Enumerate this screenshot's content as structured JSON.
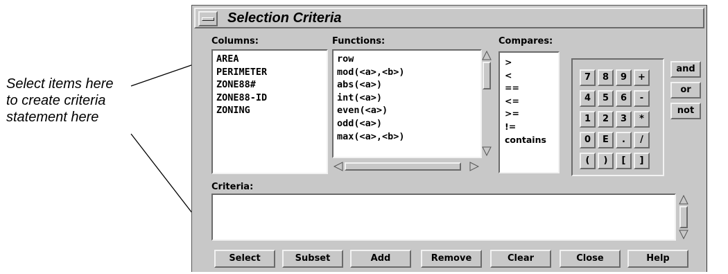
{
  "annotation": {
    "line1": "Select items here",
    "line2": "to create criteria",
    "line3": "statement here"
  },
  "window": {
    "title": "Selection Criteria"
  },
  "columns": {
    "label": "Columns:",
    "items": [
      "AREA",
      "PERIMETER",
      "ZONE88#",
      "ZONE88-ID",
      "ZONING"
    ]
  },
  "functions": {
    "label": "Functions:",
    "items": [
      "row",
      "mod(<a>,<b>)",
      "abs(<a>)",
      "int(<a>)",
      "even(<a>)",
      "odd(<a>)",
      "max(<a>,<b>)"
    ]
  },
  "compares": {
    "label": "Compares:",
    "items": [
      ">",
      "<",
      "==",
      "<=",
      ">=",
      "!=",
      "contains"
    ]
  },
  "keypad": [
    [
      "7",
      "8",
      "9",
      "+"
    ],
    [
      "4",
      "5",
      "6",
      "-"
    ],
    [
      "1",
      "2",
      "3",
      "*"
    ],
    [
      "0",
      "E",
      ".",
      "/"
    ],
    [
      "(",
      ")",
      "[",
      "]"
    ]
  ],
  "logic": [
    "and",
    "or",
    "not"
  ],
  "criteria": {
    "label": "Criteria:",
    "value": ""
  },
  "buttons": {
    "select": "Select",
    "subset": "Subset",
    "add": "Add",
    "remove": "Remove",
    "clear": "Clear",
    "close": "Close",
    "help": "Help"
  }
}
